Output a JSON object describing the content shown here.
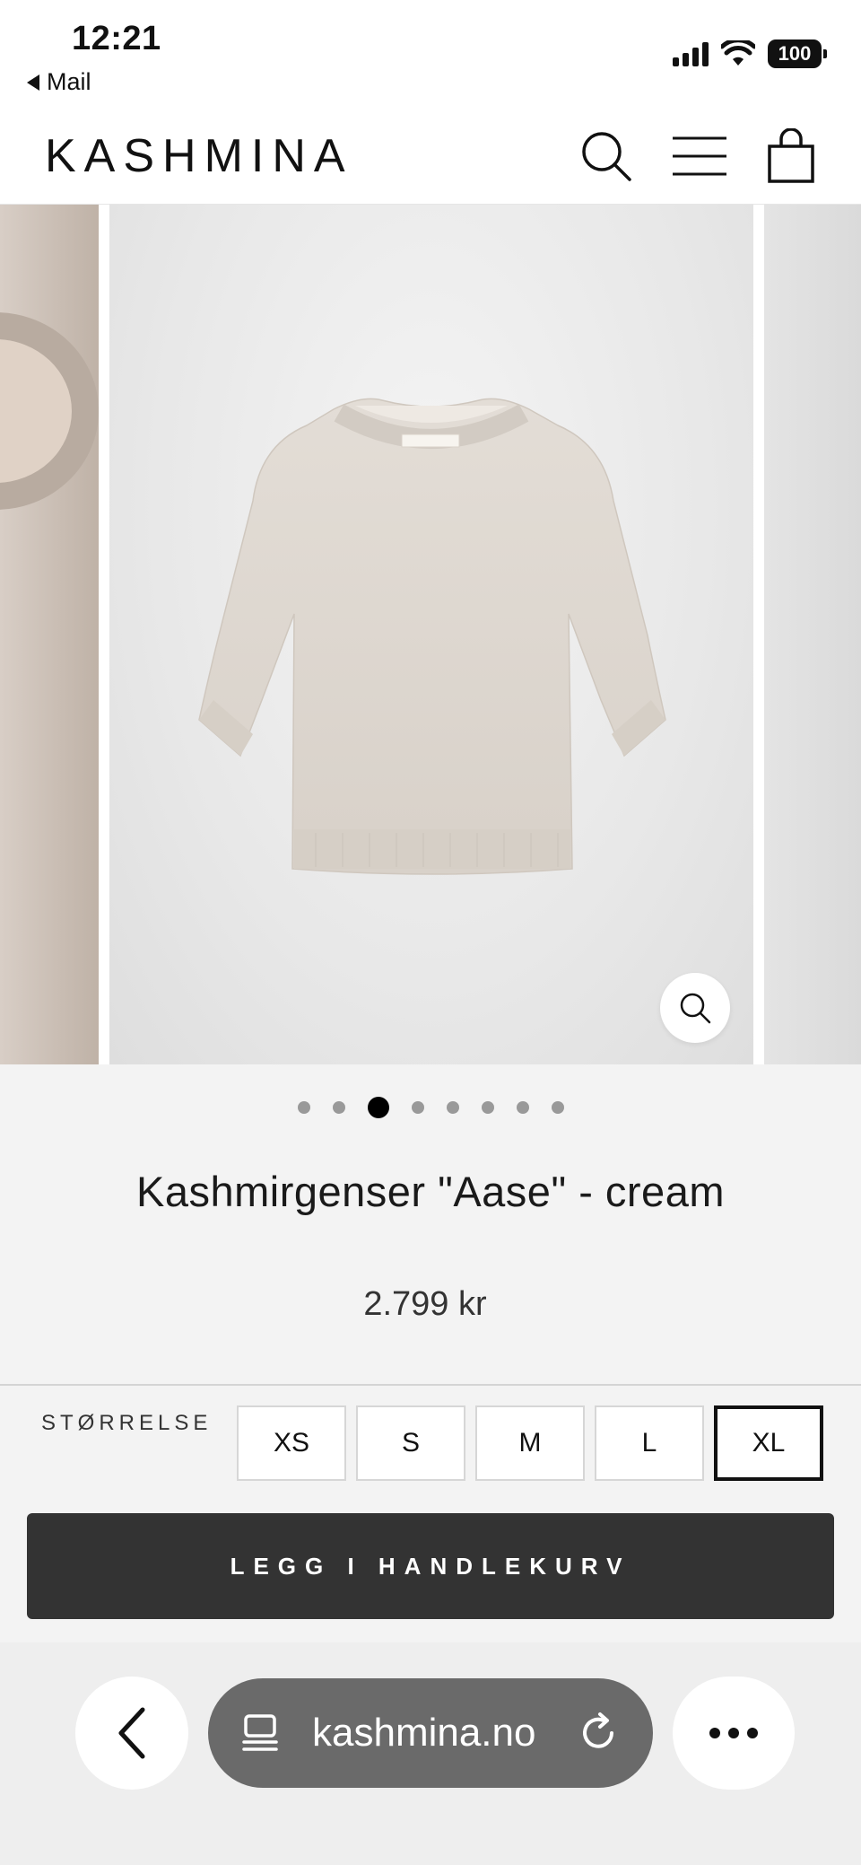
{
  "status_bar": {
    "time": "12:21",
    "back_app": "Mail",
    "battery": "100"
  },
  "header": {
    "logo": "KASHMINA",
    "icons": [
      "search-icon",
      "menu-icon",
      "shopping-bag-icon"
    ]
  },
  "gallery": {
    "dot_count": 8,
    "active_dot": 3,
    "zoom_icon": "search-icon"
  },
  "product": {
    "title": "Kashmirgenser \"Aase\" - cream",
    "price": "2.799 kr"
  },
  "size": {
    "label": "STØRRELSE",
    "options": [
      "XS",
      "S",
      "M",
      "L",
      "XL"
    ],
    "selected": "XL"
  },
  "cart": {
    "button_label": "LEGG I HANDLEKURV"
  },
  "browser": {
    "url": "kashmina.no",
    "icons": [
      "back-chevron-icon",
      "tabs-icon",
      "reload-icon",
      "more-icon"
    ]
  },
  "colors": {
    "button_bg": "#333333",
    "page_bg": "#f3f3f3",
    "url_pill": "#6a6a6a"
  }
}
